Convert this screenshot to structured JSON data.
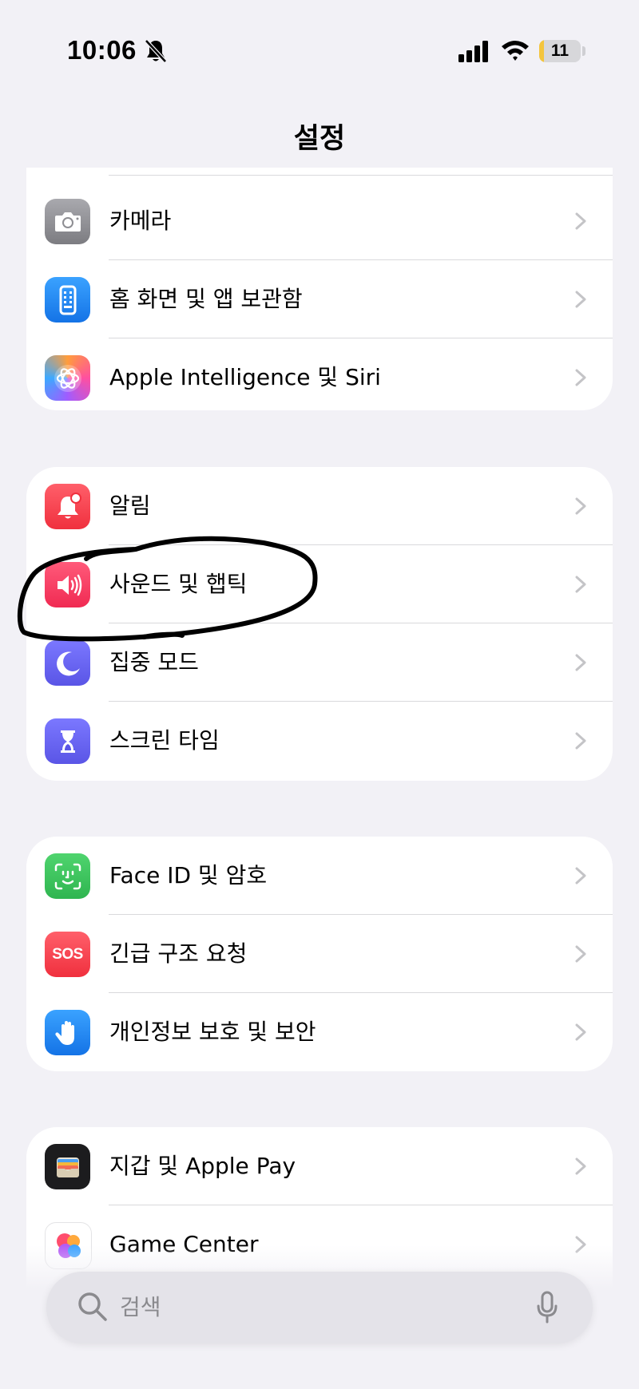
{
  "status_bar": {
    "time": "10:06",
    "battery_level": "11",
    "battery_fraction": 0.11,
    "silent_mode": true
  },
  "header": {
    "title": "설정"
  },
  "groups": [
    {
      "items": [
        {
          "label": "카메라",
          "icon": "camera-icon",
          "color": "#8e8e93"
        },
        {
          "label": "홈 화면 및 앱 보관함",
          "icon": "home-screen-icon",
          "color": "#1a84f5"
        },
        {
          "label": "Apple Intelligence 및 Siri",
          "icon": "apple-intelligence-icon",
          "color": "#f06ab0"
        }
      ]
    },
    {
      "items": [
        {
          "label": "알림",
          "icon": "notifications-icon",
          "color": "#f5414f"
        },
        {
          "label": "사운드 및 햅틱",
          "icon": "sound-icon",
          "color": "#f5385e"
        },
        {
          "label": "집중 모드",
          "icon": "focus-moon-icon",
          "color": "#5d5ae6"
        },
        {
          "label": "스크린 타임",
          "icon": "screen-time-icon",
          "color": "#5d5ae6"
        }
      ]
    },
    {
      "items": [
        {
          "label": "Face ID 및 암호",
          "icon": "face-id-icon",
          "color": "#35c759"
        },
        {
          "label": "긴급 구조 요청",
          "icon": "sos-icon",
          "color": "#f5414f",
          "icon_text": "SOS"
        },
        {
          "label": "개인정보 보호 및 보안",
          "icon": "privacy-hand-icon",
          "color": "#1a84f5"
        }
      ]
    },
    {
      "items": [
        {
          "label": "지갑 및 Apple Pay",
          "icon": "wallet-icon",
          "color": "#1c1c1e"
        },
        {
          "label": "Game Center",
          "icon": "game-center-icon",
          "color": "#ffffff"
        }
      ]
    }
  ],
  "annotation": {
    "highlighted_item": "사운드 및 햅틱",
    "stroke_color": "#000000"
  },
  "search": {
    "placeholder": "검색"
  }
}
